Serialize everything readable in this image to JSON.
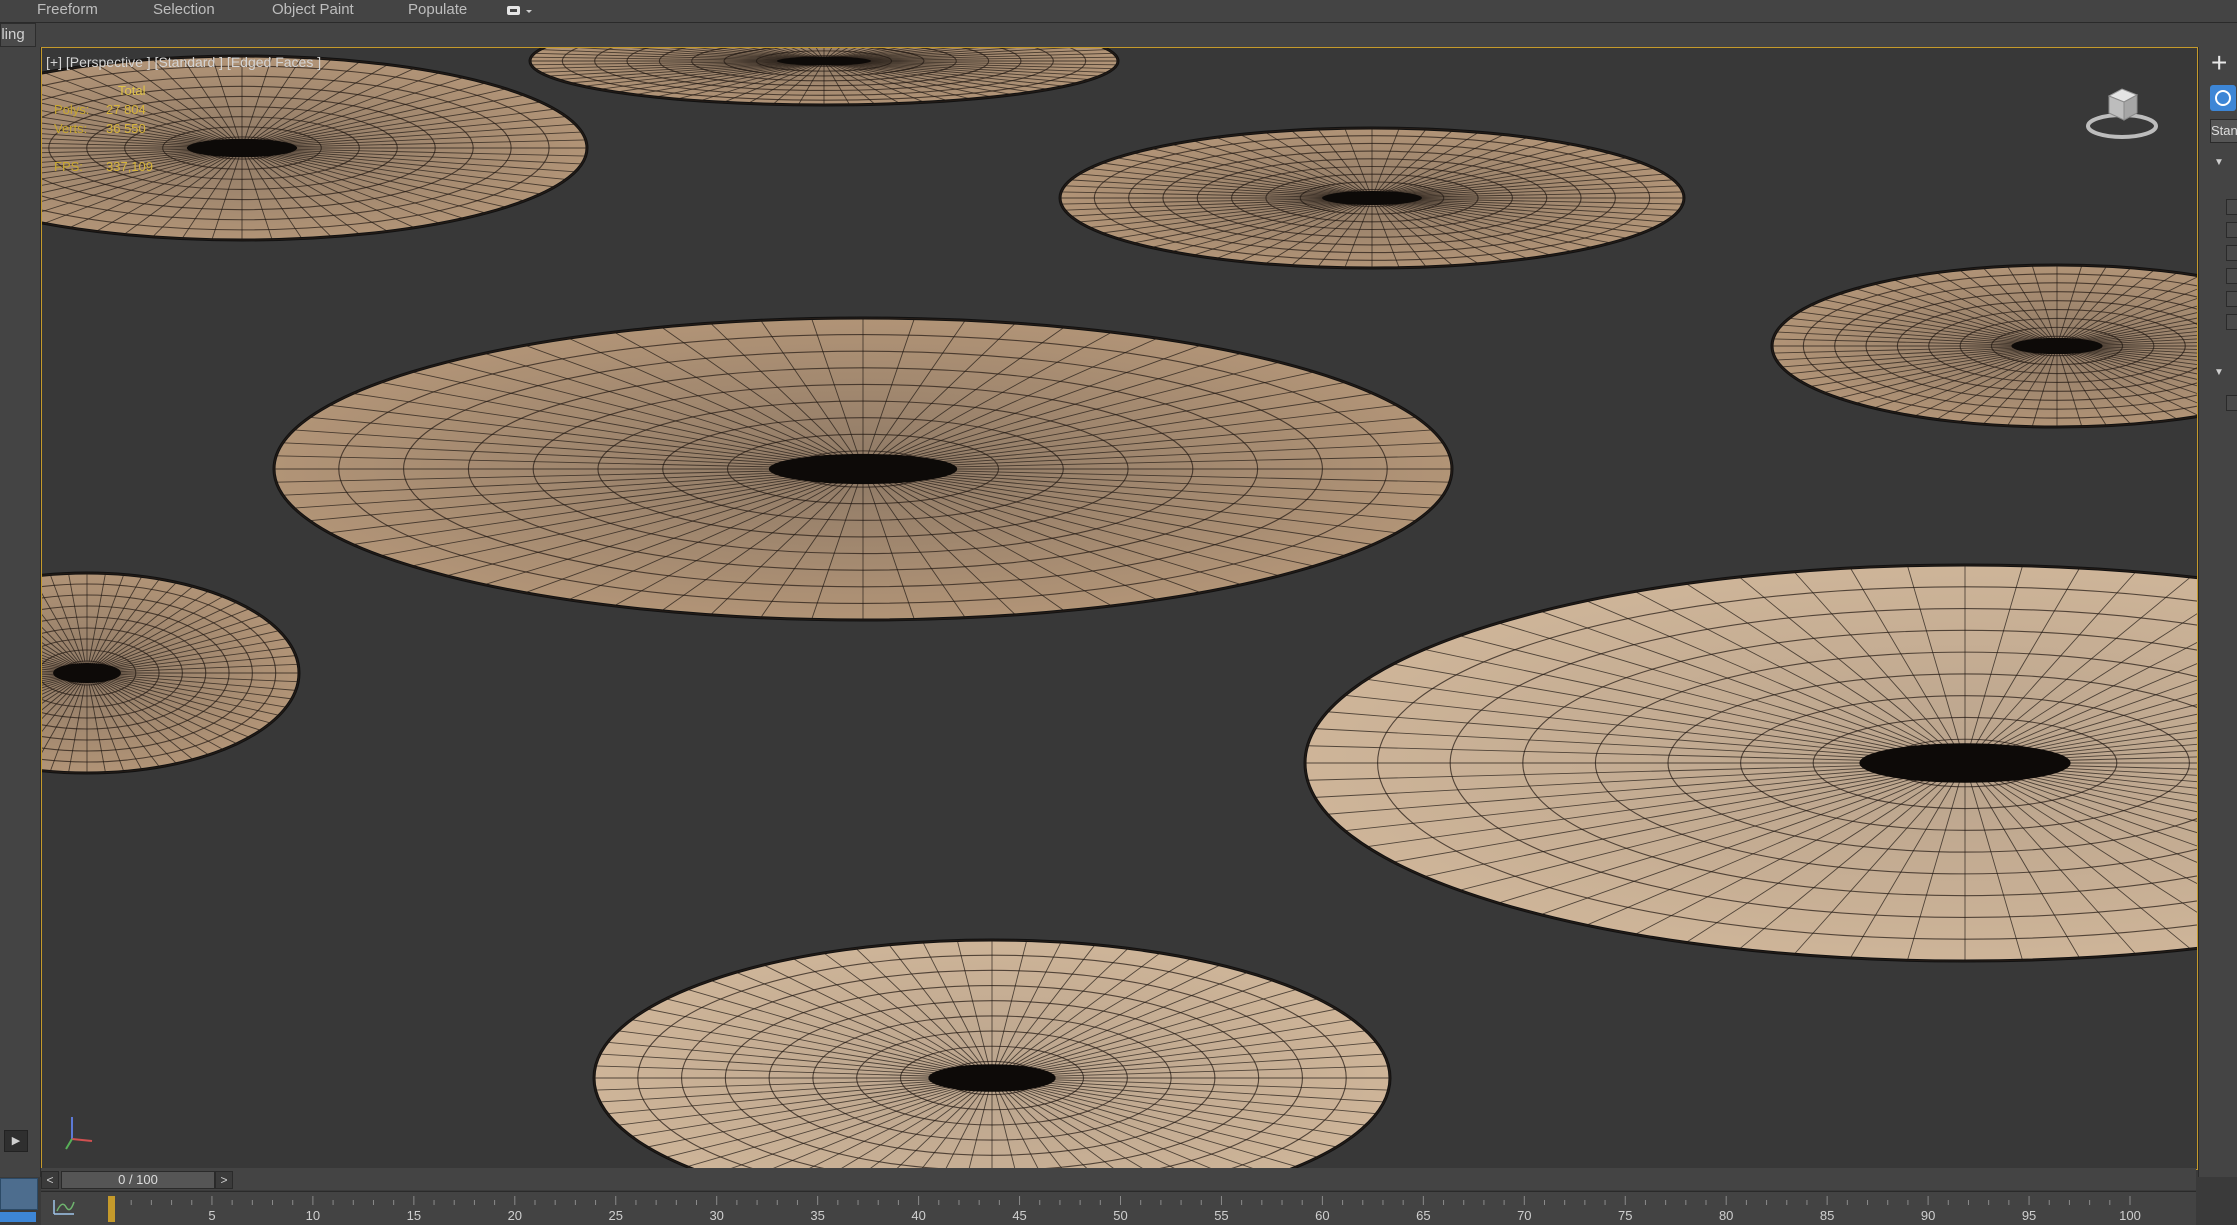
{
  "menu": {
    "items": [
      "Freeform",
      "Selection",
      "Object Paint",
      "Populate"
    ],
    "dropdown_icon": "chat-bubble-dropdown-icon"
  },
  "ribbon": {
    "active_tab": "eling"
  },
  "viewport": {
    "label": "[+] [Perspective ] [Standard ] [Edged Faces ]",
    "stats": {
      "header": "Total",
      "polys_label": "Polys:",
      "polys_value": "27 804",
      "verts_label": "Verts:",
      "verts_value": "36 550",
      "fps_label": "FPS:",
      "fps_value": "337,109"
    },
    "border_color": "#c59a2b",
    "viewcube_icon": "viewcube-icon"
  },
  "command_panel": {
    "create_icon": "plus-icon",
    "active_button_icon": "sphere-icon",
    "field_text": "Stan"
  },
  "timeline": {
    "prev": "<",
    "next": ">",
    "frame_display": "0 / 100",
    "current_frame": 0,
    "total_frames": 100,
    "ticks": [
      "5",
      "10",
      "15",
      "20",
      "25",
      "30",
      "35",
      "40",
      "45",
      "50",
      "55",
      "60",
      "65",
      "70",
      "75",
      "80",
      "85",
      "90",
      "95",
      "100"
    ]
  },
  "colors": {
    "accent_blue": "#3d86d6",
    "viewport_border": "#c59a2b",
    "stats_text": "#d6b43a",
    "background": "#383838"
  }
}
